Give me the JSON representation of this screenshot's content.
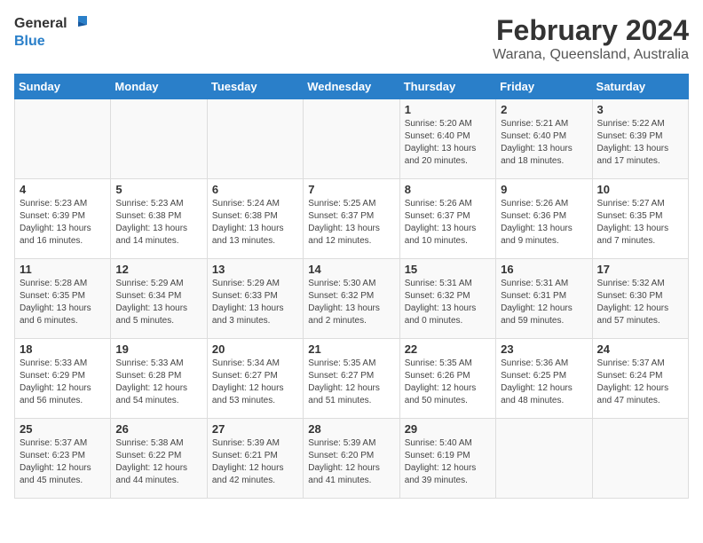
{
  "header": {
    "logo_general": "General",
    "logo_blue": "Blue",
    "month": "February 2024",
    "location": "Warana, Queensland, Australia"
  },
  "days_of_week": [
    "Sunday",
    "Monday",
    "Tuesday",
    "Wednesday",
    "Thursday",
    "Friday",
    "Saturday"
  ],
  "weeks": [
    [
      {
        "day": "",
        "info": ""
      },
      {
        "day": "",
        "info": ""
      },
      {
        "day": "",
        "info": ""
      },
      {
        "day": "",
        "info": ""
      },
      {
        "day": "1",
        "info": "Sunrise: 5:20 AM\nSunset: 6:40 PM\nDaylight: 13 hours\nand 20 minutes."
      },
      {
        "day": "2",
        "info": "Sunrise: 5:21 AM\nSunset: 6:40 PM\nDaylight: 13 hours\nand 18 minutes."
      },
      {
        "day": "3",
        "info": "Sunrise: 5:22 AM\nSunset: 6:39 PM\nDaylight: 13 hours\nand 17 minutes."
      }
    ],
    [
      {
        "day": "4",
        "info": "Sunrise: 5:23 AM\nSunset: 6:39 PM\nDaylight: 13 hours\nand 16 minutes."
      },
      {
        "day": "5",
        "info": "Sunrise: 5:23 AM\nSunset: 6:38 PM\nDaylight: 13 hours\nand 14 minutes."
      },
      {
        "day": "6",
        "info": "Sunrise: 5:24 AM\nSunset: 6:38 PM\nDaylight: 13 hours\nand 13 minutes."
      },
      {
        "day": "7",
        "info": "Sunrise: 5:25 AM\nSunset: 6:37 PM\nDaylight: 13 hours\nand 12 minutes."
      },
      {
        "day": "8",
        "info": "Sunrise: 5:26 AM\nSunset: 6:37 PM\nDaylight: 13 hours\nand 10 minutes."
      },
      {
        "day": "9",
        "info": "Sunrise: 5:26 AM\nSunset: 6:36 PM\nDaylight: 13 hours\nand 9 minutes."
      },
      {
        "day": "10",
        "info": "Sunrise: 5:27 AM\nSunset: 6:35 PM\nDaylight: 13 hours\nand 7 minutes."
      }
    ],
    [
      {
        "day": "11",
        "info": "Sunrise: 5:28 AM\nSunset: 6:35 PM\nDaylight: 13 hours\nand 6 minutes."
      },
      {
        "day": "12",
        "info": "Sunrise: 5:29 AM\nSunset: 6:34 PM\nDaylight: 13 hours\nand 5 minutes."
      },
      {
        "day": "13",
        "info": "Sunrise: 5:29 AM\nSunset: 6:33 PM\nDaylight: 13 hours\nand 3 minutes."
      },
      {
        "day": "14",
        "info": "Sunrise: 5:30 AM\nSunset: 6:32 PM\nDaylight: 13 hours\nand 2 minutes."
      },
      {
        "day": "15",
        "info": "Sunrise: 5:31 AM\nSunset: 6:32 PM\nDaylight: 13 hours\nand 0 minutes."
      },
      {
        "day": "16",
        "info": "Sunrise: 5:31 AM\nSunset: 6:31 PM\nDaylight: 12 hours\nand 59 minutes."
      },
      {
        "day": "17",
        "info": "Sunrise: 5:32 AM\nSunset: 6:30 PM\nDaylight: 12 hours\nand 57 minutes."
      }
    ],
    [
      {
        "day": "18",
        "info": "Sunrise: 5:33 AM\nSunset: 6:29 PM\nDaylight: 12 hours\nand 56 minutes."
      },
      {
        "day": "19",
        "info": "Sunrise: 5:33 AM\nSunset: 6:28 PM\nDaylight: 12 hours\nand 54 minutes."
      },
      {
        "day": "20",
        "info": "Sunrise: 5:34 AM\nSunset: 6:27 PM\nDaylight: 12 hours\nand 53 minutes."
      },
      {
        "day": "21",
        "info": "Sunrise: 5:35 AM\nSunset: 6:27 PM\nDaylight: 12 hours\nand 51 minutes."
      },
      {
        "day": "22",
        "info": "Sunrise: 5:35 AM\nSunset: 6:26 PM\nDaylight: 12 hours\nand 50 minutes."
      },
      {
        "day": "23",
        "info": "Sunrise: 5:36 AM\nSunset: 6:25 PM\nDaylight: 12 hours\nand 48 minutes."
      },
      {
        "day": "24",
        "info": "Sunrise: 5:37 AM\nSunset: 6:24 PM\nDaylight: 12 hours\nand 47 minutes."
      }
    ],
    [
      {
        "day": "25",
        "info": "Sunrise: 5:37 AM\nSunset: 6:23 PM\nDaylight: 12 hours\nand 45 minutes."
      },
      {
        "day": "26",
        "info": "Sunrise: 5:38 AM\nSunset: 6:22 PM\nDaylight: 12 hours\nand 44 minutes."
      },
      {
        "day": "27",
        "info": "Sunrise: 5:39 AM\nSunset: 6:21 PM\nDaylight: 12 hours\nand 42 minutes."
      },
      {
        "day": "28",
        "info": "Sunrise: 5:39 AM\nSunset: 6:20 PM\nDaylight: 12 hours\nand 41 minutes."
      },
      {
        "day": "29",
        "info": "Sunrise: 5:40 AM\nSunset: 6:19 PM\nDaylight: 12 hours\nand 39 minutes."
      },
      {
        "day": "",
        "info": ""
      },
      {
        "day": "",
        "info": ""
      }
    ]
  ]
}
